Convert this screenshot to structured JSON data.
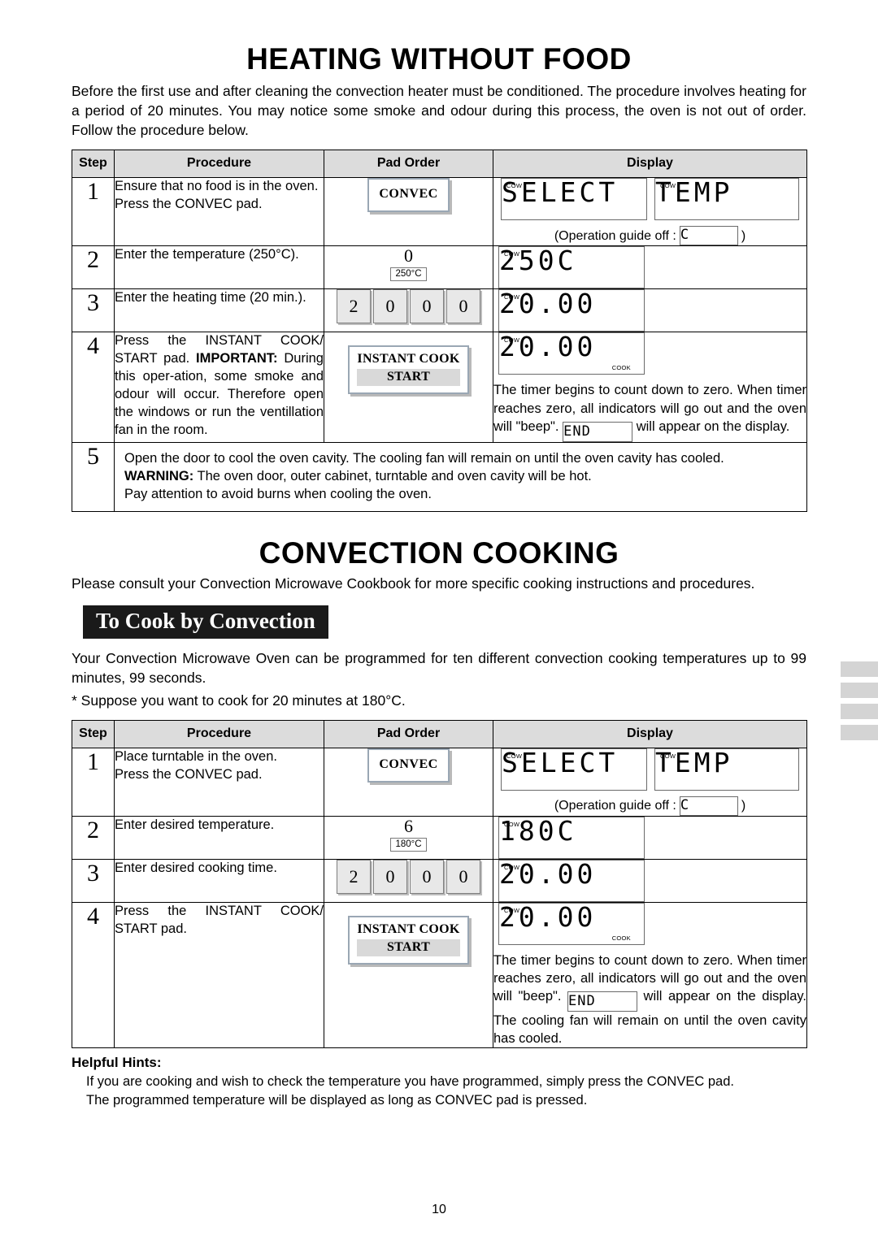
{
  "page": {
    "number": "10"
  },
  "section1": {
    "title": "HEATING WITHOUT FOOD",
    "intro": "Before the first use and after cleaning the convection heater must be conditioned. The procedure involves heating for a period of 20 minutes. You may notice some smoke and odour during this process, the oven is not out of order. Follow the procedure below.",
    "headers": [
      "Step",
      "Procedure",
      "Pad Order",
      "Display"
    ],
    "rows": [
      {
        "step": "1",
        "procedure": "Ensure that no food is in the oven.\nPress the CONVEC pad.",
        "pad_label": "CONVEC",
        "display1": "SELECT",
        "display2": "TEMP",
        "indicator1": "COW",
        "indicator2": "COW",
        "guide_prefix": "(Operation guide off :",
        "guide_value": "C",
        "guide_suffix": ")"
      },
      {
        "step": "2",
        "procedure": "Enter the temperature (250°C).",
        "key_num": "0",
        "key_label": "250°C",
        "display1": "250C",
        "indicator1": "COW"
      },
      {
        "step": "3",
        "procedure": "Enter the heating time (20 min.).",
        "keys": [
          "2",
          "0",
          "0",
          "0"
        ],
        "display1": "20.00",
        "indicator1": "COW"
      },
      {
        "step": "4",
        "procedure_line1": "Press the INSTANT COOK/ START pad.",
        "procedure_bold": "IMPORTANT:",
        "procedure_line2": " During this oper-ation, some smoke and odour will occur. Therefore open the windows or run the ventillation fan in the room.",
        "pad_line1": "INSTANT COOK",
        "pad_line2": "START",
        "display1": "20.00",
        "indicator1": "COW",
        "indicator_cook": "COOK",
        "text_a": "The timer begins to count down to zero. When timer reaches zero, all indicators will go out and the oven will \"beep\".",
        "end_value": "END",
        "text_b": "will appear on the display."
      },
      {
        "step": "5",
        "line1": "Open the door to cool the oven cavity. The cooling fan will remain on until the oven cavity has cooled.",
        "warning_label": "WARNING:",
        "line2": " The oven door, outer cabinet, turntable and oven cavity will be hot.",
        "line3": "Pay attention to avoid burns when cooling the oven."
      }
    ]
  },
  "section2": {
    "title": "CONVECTION COOKING",
    "intro": "Please consult your Convection Microwave Cookbook for more specific cooking instructions and procedures.",
    "subhead": "To Cook by Convection",
    "para1": "Your Convection Microwave Oven can be programmed for ten different convection cooking temperatures up to 99 minutes, 99 seconds.",
    "para2": "* Suppose you want to cook for 20 minutes at 180°C.",
    "headers": [
      "Step",
      "Procedure",
      "Pad Order",
      "Display"
    ],
    "rows": [
      {
        "step": "1",
        "procedure": "Place turntable in the oven.\nPress the CONVEC pad.",
        "pad_label": "CONVEC",
        "display1": "SELECT",
        "display2": "TEMP",
        "indicator1": "COW",
        "indicator2": "COW",
        "guide_prefix": "(Operation guide off :",
        "guide_value": "C",
        "guide_suffix": ")"
      },
      {
        "step": "2",
        "procedure": "Enter desired temperature.",
        "key_num": "6",
        "key_label": "180°C",
        "display1": "180C",
        "indicator1": "COW"
      },
      {
        "step": "3",
        "procedure": "Enter desired cooking time.",
        "keys": [
          "2",
          "0",
          "0",
          "0"
        ],
        "display1": "20.00",
        "indicator1": "COW"
      },
      {
        "step": "4",
        "procedure": "Press the INSTANT COOK/ START pad.",
        "pad_line1": "INSTANT COOK",
        "pad_line2": "START",
        "display1": "20.00",
        "indicator1": "COW",
        "indicator_cook": "COOK",
        "text_a": "The timer begins to count down to zero. When timer reaches zero, all indicators will go out and the oven will \"beep\".",
        "end_value": "END",
        "text_b": "will appear on the display. The cooling fan will remain on until the oven cavity has cooled."
      }
    ],
    "hints_title": "Helpful Hints:",
    "hints": [
      "If you are cooking and wish to check the temperature you have programmed, simply press the CONVEC pad.",
      "The programmed temperature will be displayed as long as CONVEC pad is pressed."
    ]
  }
}
